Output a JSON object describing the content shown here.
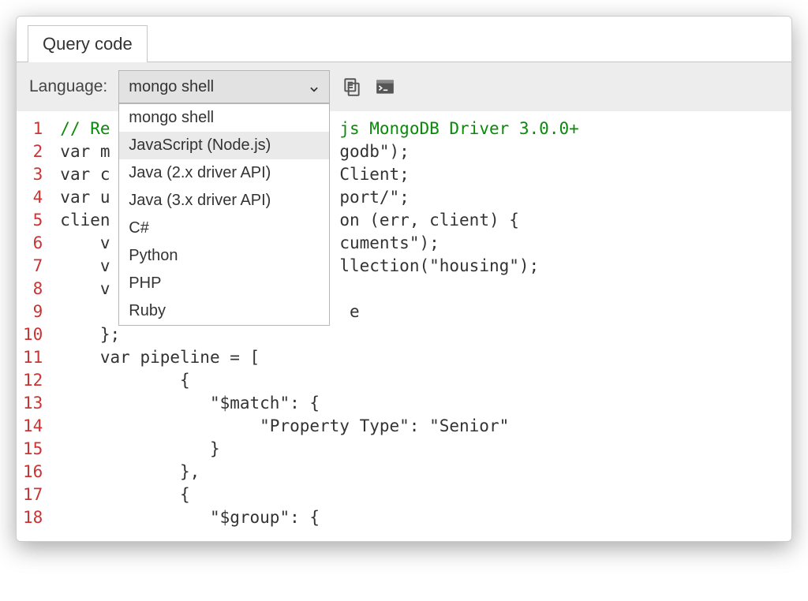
{
  "tab": {
    "label": "Query code"
  },
  "toolbar": {
    "language_label": "Language:",
    "selected_language": "mongo shell",
    "language_options": [
      "mongo shell",
      "JavaScript (Node.js)",
      "Java (2.x driver API)",
      "Java (3.x driver API)",
      "C#",
      "Python",
      "PHP",
      "Ruby"
    ],
    "highlighted_option_index": 1
  },
  "code": {
    "line_numbers": [
      1,
      2,
      3,
      4,
      5,
      6,
      7,
      8,
      9,
      10,
      11,
      12,
      13,
      14,
      15,
      16,
      17,
      18
    ],
    "lines": [
      {
        "parts": [
          {
            "t": "// Re",
            "cls": "tok-comment"
          },
          {
            "t": "                       ",
            "cls": "tok-comment"
          },
          {
            "t": "js MongoDB Driver 3.0.0+",
            "cls": "tok-comment"
          }
        ]
      },
      {
        "parts": [
          {
            "t": "var m",
            "cls": "tok-normal"
          },
          {
            "t": "                       ",
            "cls": "tok-normal"
          },
          {
            "t": "godb\");",
            "cls": "tok-normal"
          }
        ]
      },
      {
        "parts": [
          {
            "t": "var c",
            "cls": "tok-normal"
          },
          {
            "t": "                       ",
            "cls": "tok-normal"
          },
          {
            "t": "Client;",
            "cls": "tok-normal"
          }
        ]
      },
      {
        "parts": [
          {
            "t": "var u",
            "cls": "tok-normal"
          },
          {
            "t": "                       ",
            "cls": "tok-normal"
          },
          {
            "t": "port/\";",
            "cls": "tok-normal"
          }
        ]
      },
      {
        "parts": [
          {
            "t": "clien",
            "cls": "tok-normal"
          },
          {
            "t": "                       ",
            "cls": "tok-normal"
          },
          {
            "t": "on (err, client) {",
            "cls": "tok-normal"
          }
        ]
      },
      {
        "parts": [
          {
            "t": "    v",
            "cls": "tok-normal"
          },
          {
            "t": "                       ",
            "cls": "tok-normal"
          },
          {
            "t": "cuments\");",
            "cls": "tok-normal"
          }
        ]
      },
      {
        "parts": [
          {
            "t": "    v",
            "cls": "tok-normal"
          },
          {
            "t": "                       ",
            "cls": "tok-normal"
          },
          {
            "t": "llection(\"housing\");",
            "cls": "tok-normal"
          }
        ]
      },
      {
        "parts": [
          {
            "t": "    v",
            "cls": "tok-normal"
          }
        ]
      },
      {
        "parts": [
          {
            "t": "                             ",
            "cls": "tok-normal"
          },
          {
            "t": "e",
            "cls": "tok-normal"
          }
        ]
      },
      {
        "parts": [
          {
            "t": "    };",
            "cls": "tok-normal"
          }
        ]
      },
      {
        "parts": [
          {
            "t": "    var pipeline = [",
            "cls": "tok-normal"
          }
        ]
      },
      {
        "parts": [
          {
            "t": "            {",
            "cls": "tok-normal"
          }
        ]
      },
      {
        "parts": [
          {
            "t": "               \"$match\": {",
            "cls": "tok-normal"
          }
        ]
      },
      {
        "parts": [
          {
            "t": "                    \"Property Type\": \"Senior\"",
            "cls": "tok-normal"
          }
        ]
      },
      {
        "parts": [
          {
            "t": "               }",
            "cls": "tok-normal"
          }
        ]
      },
      {
        "parts": [
          {
            "t": "            },",
            "cls": "tok-normal"
          }
        ]
      },
      {
        "parts": [
          {
            "t": "            {",
            "cls": "tok-normal"
          }
        ]
      },
      {
        "parts": [
          {
            "t": "               \"$group\": {",
            "cls": "tok-normal"
          }
        ]
      }
    ]
  }
}
